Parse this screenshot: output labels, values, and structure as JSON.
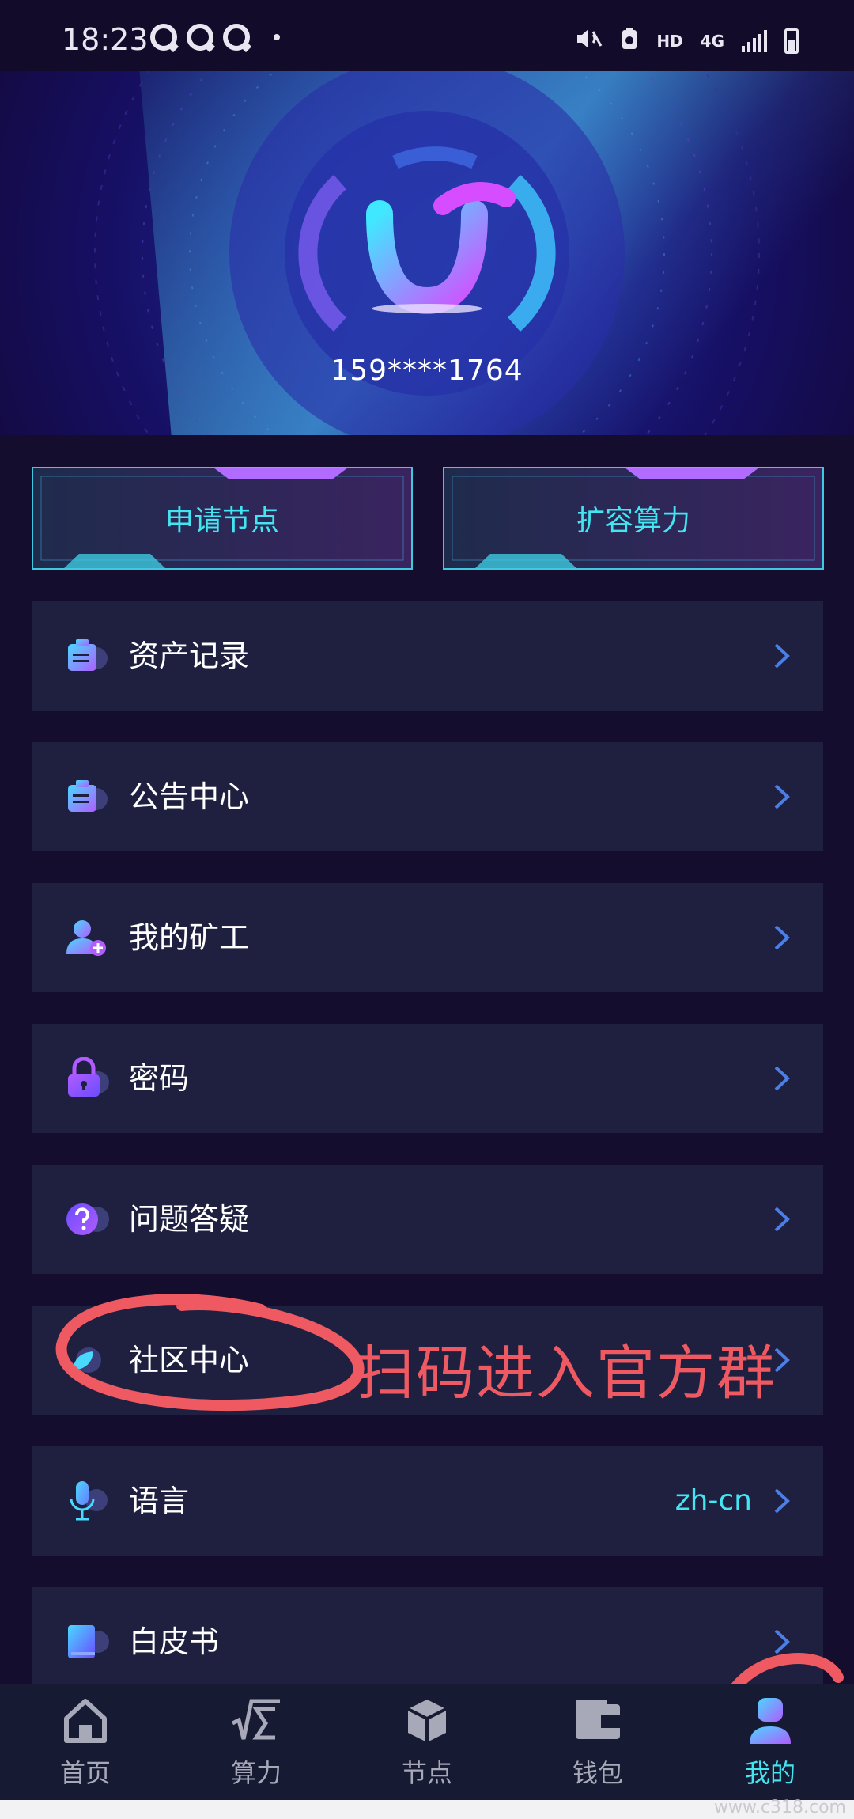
{
  "status_bar": {
    "time": "18:23",
    "network_label": "HD",
    "network_type": "4G"
  },
  "profile": {
    "phone": "159****1764"
  },
  "actions": [
    {
      "label": "申请节点"
    },
    {
      "label": "扩容算力"
    }
  ],
  "menu": [
    {
      "label": "资产记录",
      "icon": "clipboard-icon"
    },
    {
      "label": "公告中心",
      "icon": "clipboard-icon"
    },
    {
      "label": "我的矿工",
      "icon": "user-add-icon"
    },
    {
      "label": "密码",
      "icon": "lock-icon"
    },
    {
      "label": "问题答疑",
      "icon": "question-icon"
    },
    {
      "label": "社区中心",
      "icon": "leaf-icon"
    },
    {
      "label": "语言",
      "icon": "microphone-icon",
      "value": "zh-cn"
    },
    {
      "label": "白皮书",
      "icon": "book-icon"
    }
  ],
  "annotation": {
    "text": "扫码进入官方群",
    "color": "#ef5a62"
  },
  "bottom_nav": [
    {
      "label": "首页",
      "icon": "home-icon"
    },
    {
      "label": "算力",
      "icon": "sigma-icon"
    },
    {
      "label": "节点",
      "icon": "cube-icon"
    },
    {
      "label": "钱包",
      "icon": "wallet-icon"
    },
    {
      "label": "我的",
      "icon": "profile-icon",
      "active": true
    }
  ],
  "colors": {
    "accent": "#43e5f0",
    "background": "#140d2e",
    "card": "#1f2040"
  },
  "watermark": "www.c318.com"
}
